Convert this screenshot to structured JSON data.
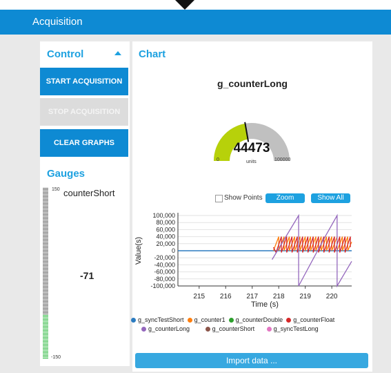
{
  "window": {
    "title": "Acquisition"
  },
  "control": {
    "heading": "Control",
    "start_label": "START ACQUISITION",
    "stop_label": "STOP ACQUISITION",
    "clear_label": "CLEAR GRAPHS"
  },
  "gauges": {
    "heading": "Gauges",
    "name": "counterShort",
    "max_label": "150",
    "min_label": "-150",
    "value_label": "-71",
    "value": -71,
    "min": -150,
    "max": 150
  },
  "chart": {
    "heading": "Chart",
    "gauge_title": "g_counterLong",
    "gauge_value_label": "44473",
    "gauge_value": 44473,
    "gauge_min_label": "0",
    "gauge_max_label": "100000",
    "gauge_units": "units",
    "gauge_min": 0,
    "gauge_max": 100000,
    "show_points_label": "Show Points",
    "zoom_label": "Zoom",
    "show_all_label": "Show All",
    "import_label": "Import data ..."
  },
  "chart_data": {
    "type": "line",
    "xlabel": "Time (s)",
    "ylabel": "Value(s)",
    "xlim": [
      214.2,
      220.75
    ],
    "ylim": [
      -100000,
      100000
    ],
    "x_ticks": [
      "215",
      "216",
      "217",
      "218",
      "219",
      "220"
    ],
    "y_ticks": [
      "100,000",
      "80,000",
      "60,000",
      "40,000",
      "20,000",
      "0",
      "-20,000",
      "-40,000",
      "-60,000",
      "-80,000",
      "-100,000"
    ],
    "grid": true,
    "legend_position": "bottom",
    "series": [
      {
        "name": "g_syncTestShort",
        "color": "#2b7bc0",
        "x": [
          214.2,
          217.8,
          220.75
        ],
        "y": [
          0,
          0,
          0
        ]
      },
      {
        "name": "g_counter1",
        "color": "#ff7f0e",
        "x": [
          217.8,
          218.0,
          218.0,
          218.2,
          218.2,
          218.4,
          218.4,
          218.6,
          218.6,
          218.8,
          218.8,
          219.0,
          219.0,
          219.2,
          219.2,
          219.4,
          219.4,
          219.6,
          219.6,
          219.8,
          219.8,
          220.0,
          220.0,
          220.2,
          220.2,
          220.4,
          220.4,
          220.6,
          220.6,
          220.75
        ],
        "y": [
          0,
          40000,
          0,
          40000,
          0,
          40000,
          0,
          40000,
          0,
          40000,
          0,
          40000,
          0,
          40000,
          0,
          40000,
          0,
          40000,
          0,
          40000,
          0,
          40000,
          0,
          40000,
          0,
          40000,
          0,
          40000,
          0,
          25000
        ]
      },
      {
        "name": "g_counterDouble",
        "color": "#2ca02c",
        "x": [],
        "y": []
      },
      {
        "name": "g_counterFloat",
        "color": "#d62728",
        "x": [
          217.8,
          217.9,
          218.1,
          218.1,
          218.3,
          218.3,
          218.5,
          218.5,
          218.7,
          218.7,
          218.9,
          218.9,
          219.1,
          219.1,
          219.3,
          219.3,
          219.5,
          219.5,
          219.7,
          219.7,
          219.9,
          219.9,
          220.1,
          220.1,
          220.3,
          220.3,
          220.5,
          220.5,
          220.7,
          220.7
        ],
        "y": [
          10000,
          -5000,
          40000,
          -5000,
          40000,
          -5000,
          40000,
          -5000,
          40000,
          -5000,
          40000,
          -5000,
          40000,
          -5000,
          40000,
          -5000,
          40000,
          -5000,
          40000,
          -5000,
          40000,
          -5000,
          40000,
          -5000,
          40000,
          -5000,
          40000,
          -5000,
          40000,
          10000
        ]
      },
      {
        "name": "g_counterLong",
        "color": "#9467bd",
        "x": [
          217.75,
          218.75,
          218.75,
          219.75,
          220.2,
          220.2,
          220.75
        ],
        "y": [
          -25000,
          100000,
          -100000,
          40000,
          100000,
          -100000,
          -30000
        ]
      },
      {
        "name": "g_counterShort",
        "color": "#8c564b",
        "x": [],
        "y": []
      },
      {
        "name": "g_syncTestLong",
        "color": "#e377c2",
        "x": [],
        "y": []
      }
    ]
  }
}
